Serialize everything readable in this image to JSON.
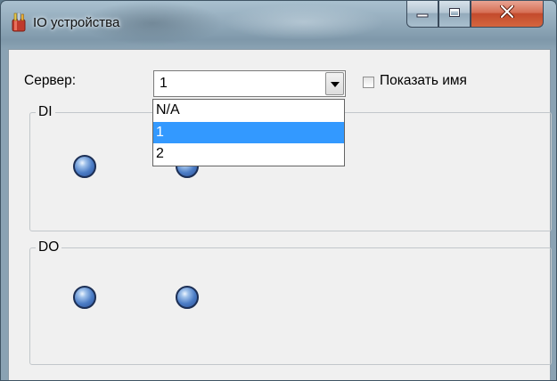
{
  "window": {
    "title": "IO устройства",
    "icon": "tools-icon",
    "buttons": {
      "minimize": "minimize-icon",
      "maximize": "maximize-icon",
      "close": "close-icon"
    }
  },
  "server": {
    "label": "Сервер:",
    "selected": "1",
    "options": [
      "N/A",
      "1",
      "2"
    ],
    "highlighted_option": "1"
  },
  "show_name": {
    "label": "Показать имя",
    "checked": false
  },
  "groups": {
    "di": {
      "title": "DI",
      "indicator_count": 2
    },
    "do": {
      "title": "DO",
      "indicator_count": 2
    }
  },
  "colors": {
    "selection": "#3399ff",
    "client_bg": "#f0f0f0",
    "led": "#4c7dc6",
    "close_button": "#c34a2c"
  }
}
